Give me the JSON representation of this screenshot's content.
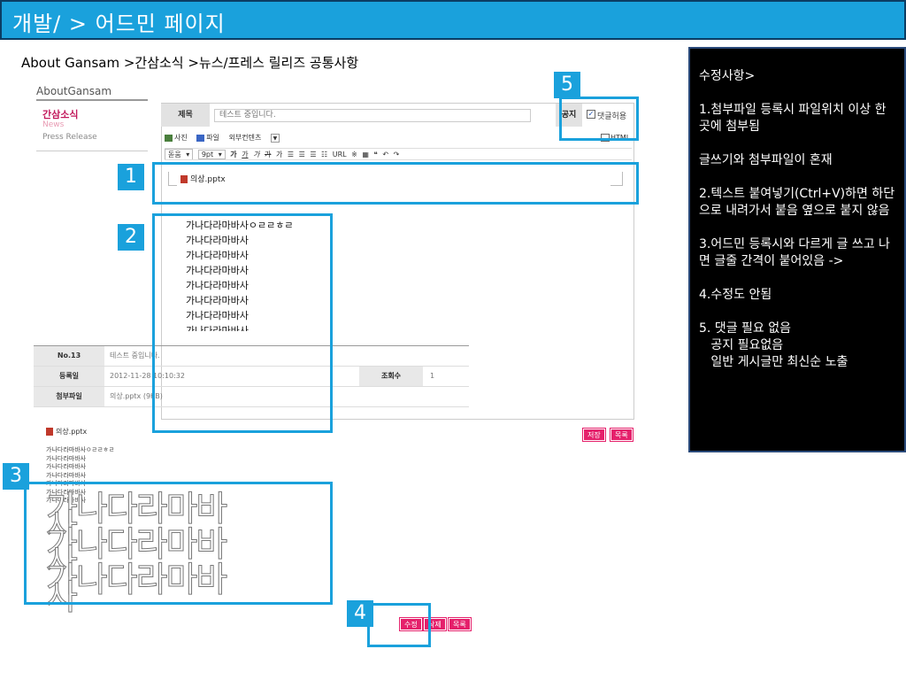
{
  "slide": {
    "title": "개발/ > 어드민 페이지",
    "breadcrumb": "About Gansam >간삼소식 >뉴스/프레스 릴리즈 공통사항"
  },
  "nav": {
    "heading": "AboutGansam",
    "category": "간삼소식",
    "sub_items": [
      "News",
      "Press Release"
    ]
  },
  "editor": {
    "title_label": "제목",
    "title_value": "테스트 중입니다.",
    "notice_label": "공지",
    "comment_checkbox": "✓",
    "comment_label": "댓글허용",
    "attach_items": [
      "사진",
      "파일",
      "외부컨텐츠"
    ],
    "html_label": "HTML",
    "toolbar": [
      "돋움",
      "9pt",
      "가",
      "가",
      "가",
      "가",
      "가",
      "URL",
      "※"
    ],
    "attached_file": "의상.pptx",
    "pasted_lines": [
      "가나다라마바사ㅇㄹㄹㅎㄹ",
      "가나다라마바사",
      "가나다라마바사",
      "가나다라마바사",
      "가나다라마바사",
      "가나다라마바사",
      "가나다라마바사",
      "가나다라마바사"
    ],
    "save_button": "저장",
    "list_button": "목록"
  },
  "view": {
    "number_label": "No.13",
    "number_value": "테스트 중입니다.",
    "date_label": "등록일",
    "date_value": "2012-11-28 10:10:32",
    "views_label": "조회수",
    "views_value": "1",
    "attach_label": "첨부파일",
    "attach_value": "의상.pptx (9KB)",
    "file_link": "의상.pptx",
    "content_lines": [
      "가나다라마바사ㅇㄹㄹㅎㄹ",
      "가나다라마바사",
      "가나다라마바사",
      "가나다라마바사",
      "가나다라마바사",
      "가나다라마바사",
      "가나다라마바사"
    ],
    "big_lines": [
      "가나다라마바사",
      "가나다라마바사",
      "가나다라마바사"
    ],
    "edit_button": "수정",
    "delete_button": "삭제",
    "list_button": "목록"
  },
  "callouts": [
    "1",
    "2",
    "3",
    "4",
    "5"
  ],
  "notes": [
    "수정사항>",
    "1.첨부파일 등록시 파일위치 이상 한 곳에 첨부됨",
    "글쓰기와 첨부파일이 혼재",
    "2.텍스트 붙여넣기(Ctrl+V)하면 하단으로 내려가서 붙음 옆으로 붙지 않음",
    "3.어드민 등록시와 다르게 글 쓰고 나면 글줄 간격이 붙어있음 ->",
    "4.수정도 안됨",
    "5. 댓글 필요 없음\n   공지 필요없음\n   일반 게시글만 최신순 노출"
  ],
  "colors": {
    "accent": "#1aa1dc",
    "pink_button": "#e5206b",
    "notes_bg": "#000000"
  }
}
